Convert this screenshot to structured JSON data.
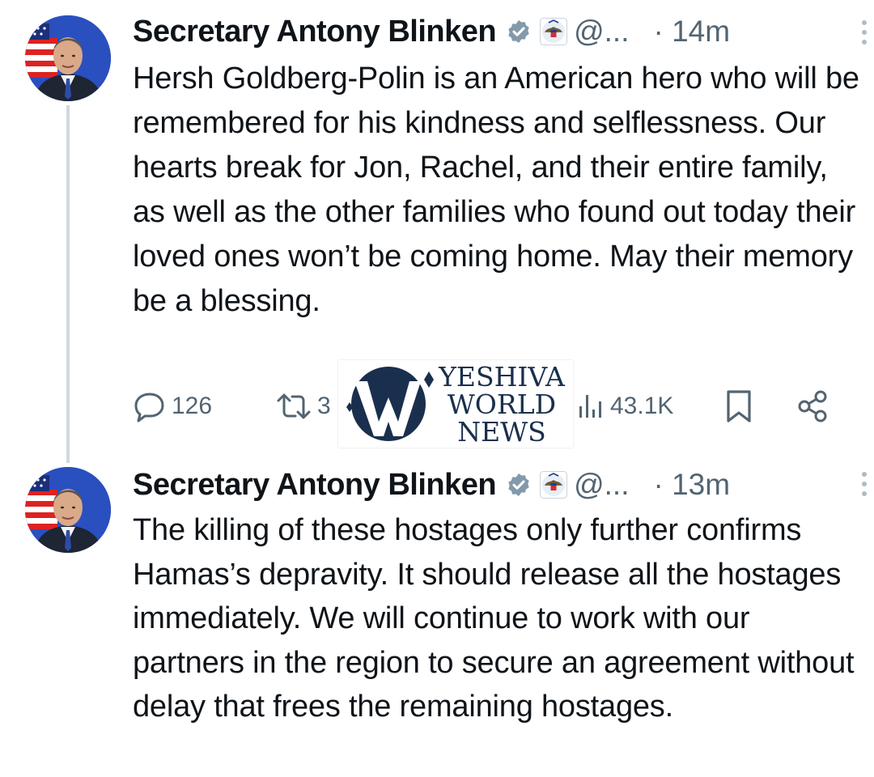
{
  "tweets": [
    {
      "author": {
        "name": "Secretary Antony Blinken",
        "handle": "@...",
        "verified_badge": "gray-verified-check-icon",
        "affiliation_icon": "us-state-department-seal-icon"
      },
      "time": "· 14m",
      "text": "Hersh Goldberg-Polin is an American hero who will be remembered for his kindness and selflessness. Our hearts break for Jon, Rachel, and their entire family, as well as the other families who found out today their loved ones won’t be coming home. May their memory be a blessing.",
      "actions": {
        "reply_count": "126",
        "repost_count": "3",
        "views_count": "43.1K"
      }
    },
    {
      "author": {
        "name": "Secretary Antony Blinken",
        "handle": "@...",
        "verified_badge": "gray-verified-check-icon",
        "affiliation_icon": "us-state-department-seal-icon"
      },
      "time": "· 13m",
      "text": "The killing of these hostages only further confirms Hamas’s depravity. It should release all the hostages immediately. We will continue to work with our partners in the region to secure an agreement without delay that frees the remaining hostages."
    }
  ],
  "watermark": {
    "lines": [
      "YESHIVA",
      "WORLD",
      "NEWS"
    ]
  },
  "colors": {
    "text": "#0f1419",
    "secondary": "#536471",
    "thread_line": "#cfd9de",
    "watermark": "#1a2f4d"
  }
}
